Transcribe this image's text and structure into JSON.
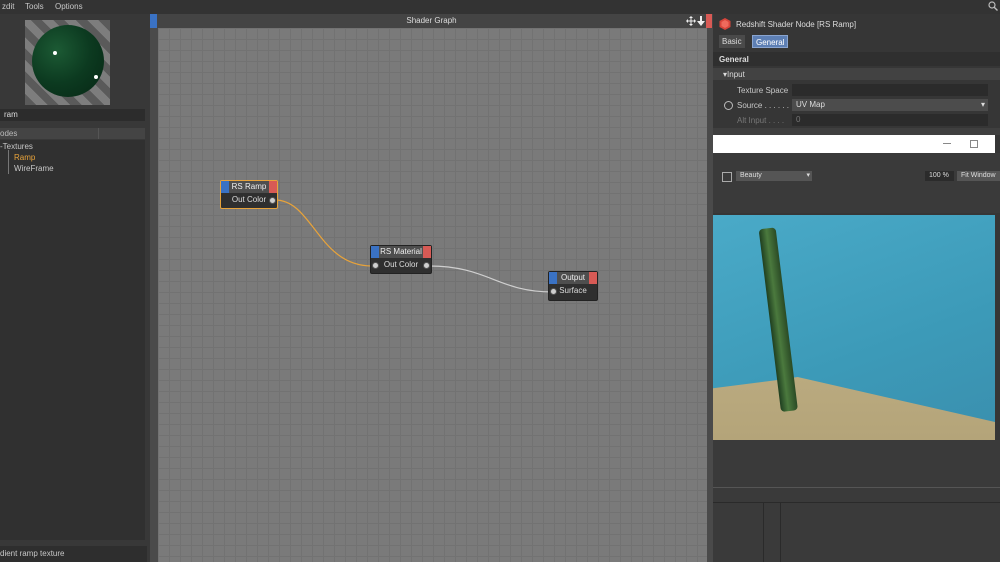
{
  "menu": {
    "items": [
      "zdit",
      "Tools",
      "Options"
    ]
  },
  "left": {
    "search_value": "ram",
    "nodes_header": "odes",
    "tree": {
      "category": "Textures",
      "items": [
        "Ramp",
        "WireFrame"
      ]
    },
    "status": "dient ramp texture"
  },
  "graph": {
    "title": "Shader Graph",
    "nodes": {
      "ramp": {
        "title": "RS Ramp",
        "port": "Out Color"
      },
      "material": {
        "title": "RS Material",
        "port": "Out Color"
      },
      "output": {
        "title": "Output",
        "port": "Surface"
      }
    }
  },
  "inspector": {
    "title": "Redshift Shader Node [RS Ramp]",
    "tabs": [
      "Basic",
      "General"
    ],
    "active_tab": "General",
    "section": "General",
    "group": "Input",
    "texture_space_label": "Texture Space",
    "source_label": "Source . . . . . .",
    "source_value": "UV Map",
    "alt_input_label": "Alt Input . . . .",
    "alt_input_value": "0"
  },
  "ipr": {
    "aov_value": "Beauty",
    "zoom_value": "100 %",
    "fit_label": "Fit Window"
  },
  "colors": {
    "accent_selected": "#e8a33a",
    "active_tree_item": "#e8a33a",
    "node_header_blue": "#3a72c4",
    "node_header_red": "#d85a55",
    "active_tab": "#5d7fb4"
  }
}
